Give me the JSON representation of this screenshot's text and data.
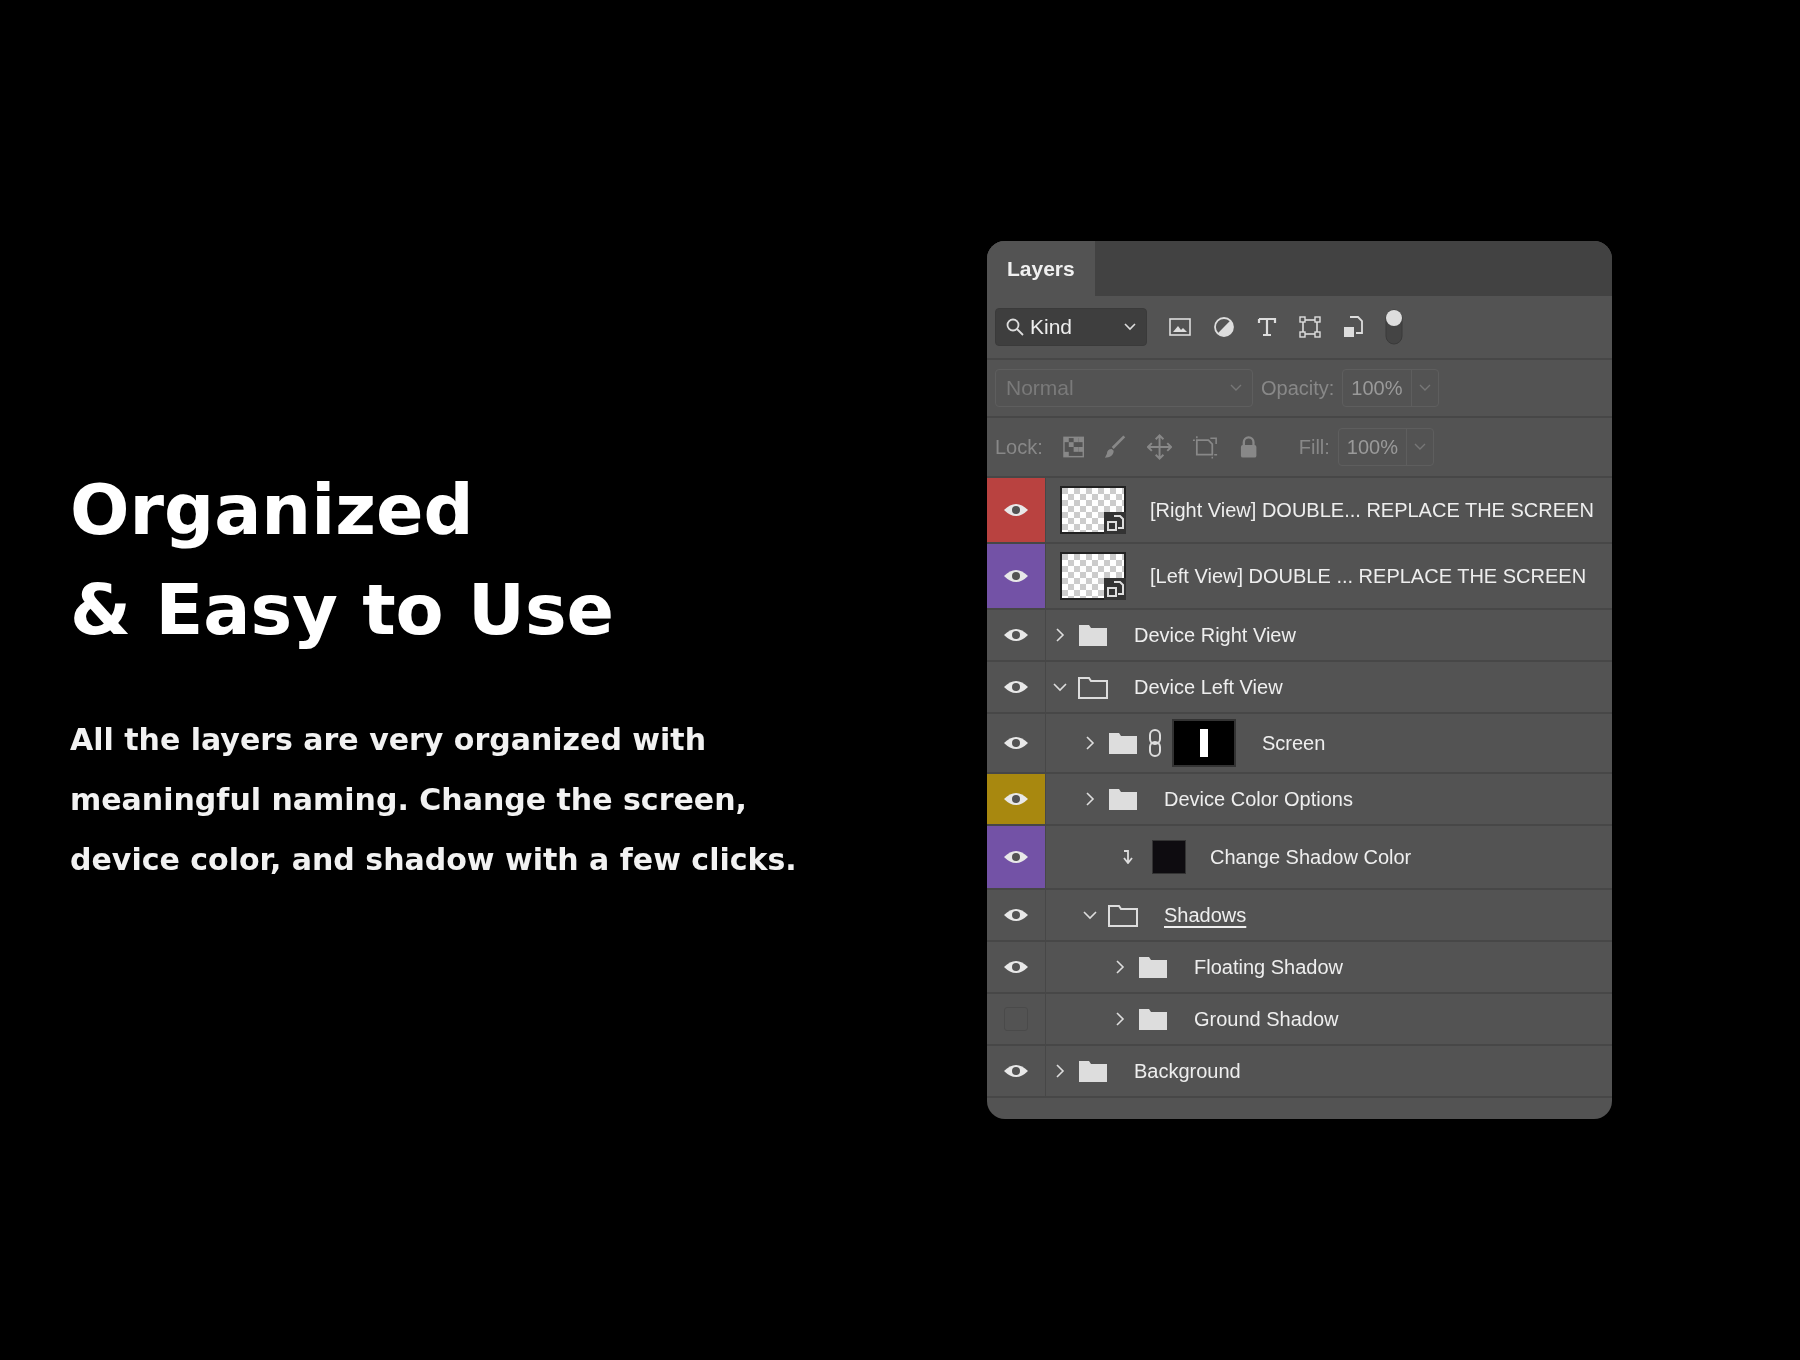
{
  "headline": [
    "Organized",
    "& Easy to Use"
  ],
  "description": "All the layers are very organized with meaningful naming. Change the screen, device color, and shadow with a few clicks.",
  "panel": {
    "tabs": [
      {
        "label": "Layers",
        "selected": true
      }
    ],
    "filter": {
      "value": "Kind",
      "filter_on": true
    },
    "blend_mode": {
      "value": "Normal",
      "disabled": true
    },
    "opacity": {
      "label": "Opacity:",
      "value": "100%",
      "disabled": true
    },
    "lock": {
      "label": "Lock:"
    },
    "fill": {
      "label": "Fill:",
      "value": "100%",
      "disabled": true
    },
    "layers": [
      {
        "name": "[Right View] DOUBLE... REPLACE THE SCREEN",
        "kind": "smart",
        "visible": true,
        "color": "#b94240"
      },
      {
        "name": "[Left View] DOUBLE ... REPLACE THE SCREEN",
        "kind": "smart",
        "visible": true,
        "color": "#7352a6"
      },
      {
        "name": "Device Right View",
        "kind": "folder",
        "visible": true,
        "expanded": false
      },
      {
        "name": "Device Left View",
        "kind": "folder",
        "visible": true,
        "expanded": true,
        "children": [
          {
            "name": "Screen",
            "kind": "folder",
            "visible": true,
            "expanded": false,
            "mask": true
          },
          {
            "name": "Device Color Options",
            "kind": "folder",
            "visible": true,
            "expanded": false,
            "color": "#a8880f"
          },
          {
            "name": "Change Shadow Color",
            "kind": "fill",
            "visible": true,
            "clipped": true,
            "color": "#7352a6"
          },
          {
            "name": "Shadows",
            "kind": "folder",
            "visible": true,
            "expanded": true,
            "clip_base": true,
            "children": [
              {
                "name": "Floating Shadow",
                "kind": "folder",
                "visible": true,
                "expanded": false
              },
              {
                "name": "Ground Shadow",
                "kind": "folder",
                "visible": false,
                "expanded": false
              }
            ]
          }
        ]
      },
      {
        "name": "Background",
        "kind": "folder",
        "visible": true,
        "expanded": false
      }
    ]
  }
}
